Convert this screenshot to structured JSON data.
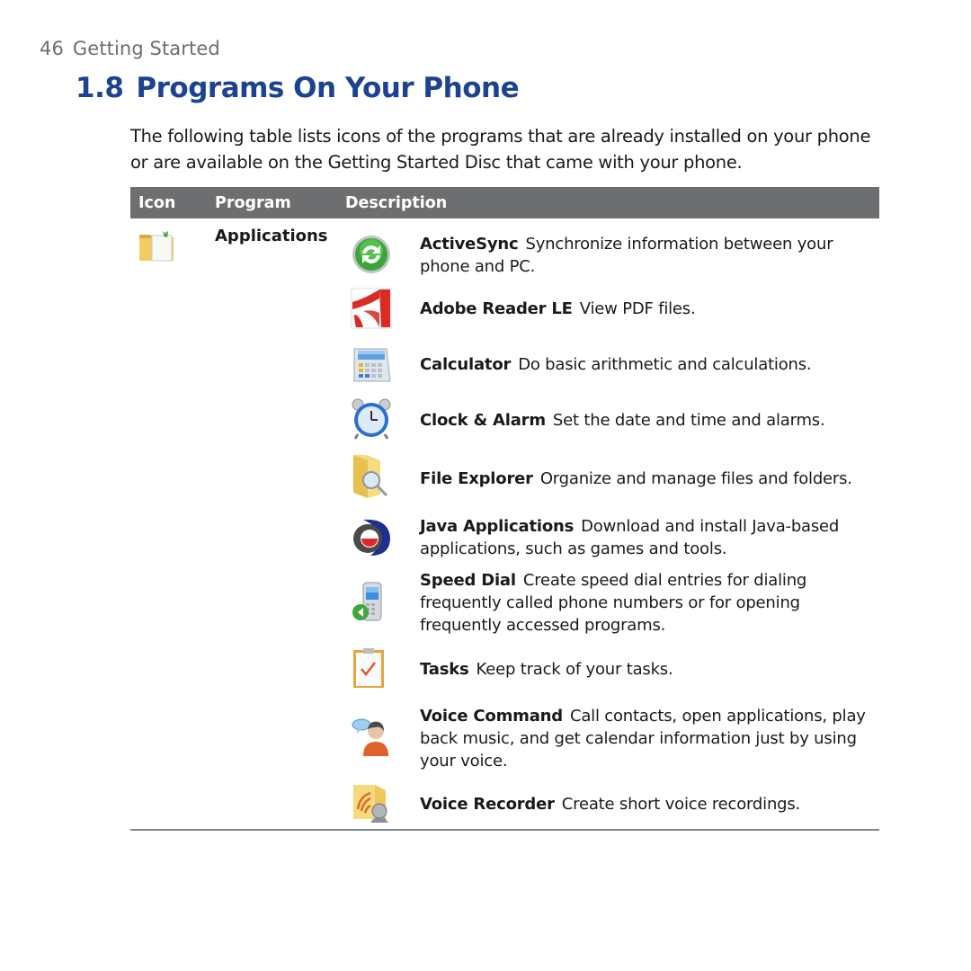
{
  "page": {
    "number": "46",
    "running_head": "Getting Started"
  },
  "section": {
    "number": "1.8",
    "title": "Programs On Your Phone",
    "intro": "The following table lists icons of the programs that are already installed on your phone or are available on the Getting Started Disc that came with your phone."
  },
  "table": {
    "headers": {
      "icon": "Icon",
      "program": "Program",
      "description": "Description"
    },
    "category": {
      "label": "Applications",
      "icon": "applications-folder-icon"
    },
    "entries": [
      {
        "name": "ActiveSync",
        "description": "Synchronize information between your phone and PC.",
        "icon": "activesync-icon"
      },
      {
        "name": "Adobe Reader LE",
        "description": "View PDF files.",
        "icon": "adobe-reader-icon"
      },
      {
        "name": "Calculator",
        "description": "Do basic arithmetic and calculations.",
        "icon": "calculator-icon"
      },
      {
        "name": "Clock & Alarm",
        "description": "Set the date and time and alarms.",
        "icon": "alarm-clock-icon"
      },
      {
        "name": "File Explorer",
        "description": "Organize and manage files and folders.",
        "icon": "file-explorer-icon"
      },
      {
        "name": "Java Applications",
        "description": "Download and install Java-based applications, such as games and tools.",
        "icon": "java-icon"
      },
      {
        "name": "Speed Dial",
        "description": "Create speed dial entries for dialing frequently called phone numbers or for opening frequently accessed programs.",
        "icon": "speed-dial-icon"
      },
      {
        "name": "Tasks",
        "description": "Keep track of your tasks.",
        "icon": "tasks-icon"
      },
      {
        "name": "Voice Command",
        "description": "Call contacts, open applications, play back music, and get calendar information just by using your voice.",
        "icon": "voice-command-icon"
      },
      {
        "name": "Voice Recorder",
        "description": "Create short voice recordings.",
        "icon": "voice-recorder-icon"
      }
    ]
  },
  "colors": {
    "title": "#1c4391",
    "header_bar": "#6d6e70",
    "running_head": "#6b6f72"
  }
}
